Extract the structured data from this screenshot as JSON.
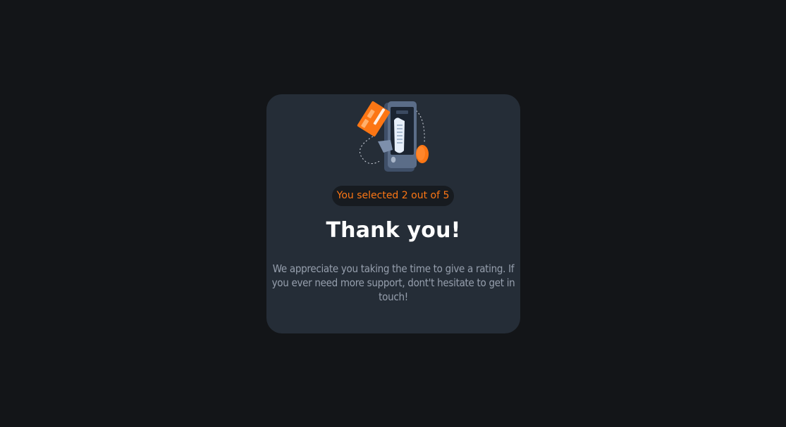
{
  "thank_you_card": {
    "illustration_icon": "payment-phone-card-illustration",
    "selection_badge": "You selected 2 out of 5",
    "title": "Thank you!",
    "message": "We appreciate you taking the time to give a rating. If you ever need more support, dont't hesitate to get in touch!"
  },
  "colors": {
    "page_background": "#131518",
    "card_background": "#252d37",
    "accent": "#fc7614",
    "badge_background": "#171b20",
    "title": "#ffffff",
    "body_text": "#969fad"
  },
  "rating": {
    "selected": 2,
    "max": 5
  }
}
